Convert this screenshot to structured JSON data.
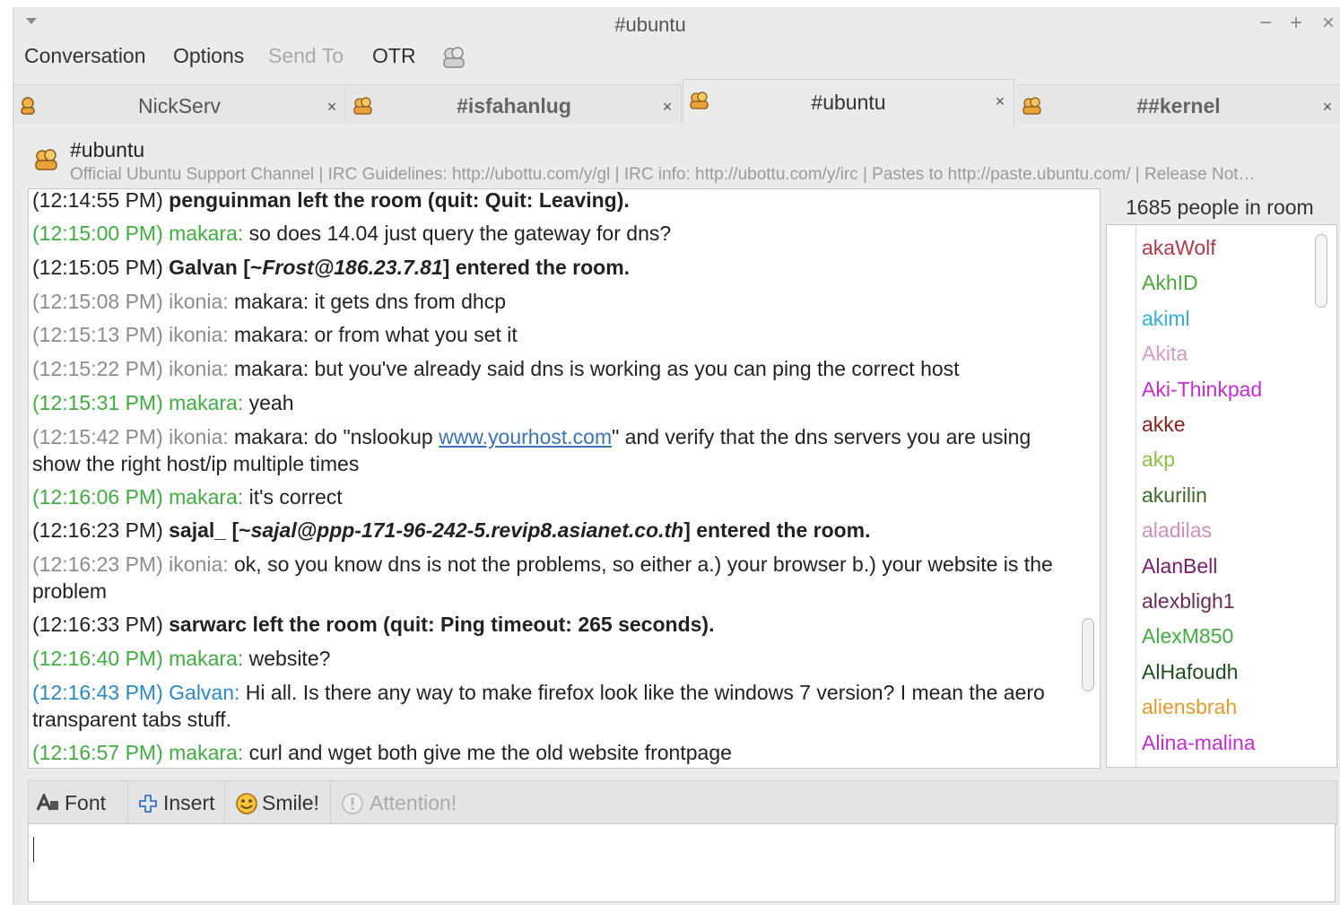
{
  "window": {
    "title": "#ubuntu",
    "minimize": "−",
    "maximize": "+",
    "close": "×"
  },
  "menubar": [
    "Conversation",
    "Options",
    "Send To",
    "OTR"
  ],
  "tabs": [
    {
      "label": "NickServ",
      "close": "×"
    },
    {
      "label": "#isfahanlug",
      "close": "×"
    },
    {
      "label": "#ubuntu",
      "close": "×"
    },
    {
      "label": "##kernel",
      "close": "×"
    }
  ],
  "topic": {
    "channel": "#ubuntu",
    "text": "Official Ubuntu Support Channel | IRC Guidelines: http://ubottu.com/y/gl | IRC info: http://ubottu.com/y/irc | Pastes to http://paste.ubuntu.com/ | Release Not…"
  },
  "messages": [
    {
      "time": "(12:14:55 PM)",
      "sys": "penguinman left the room (quit: Quit: Leaving)."
    },
    {
      "time": "(12:15:00 PM)",
      "nick": "makara:",
      "text": "so does 14.04 just query the gateway for dns?"
    },
    {
      "time": "(12:15:05 PM)",
      "sys_a": "Galvan [~",
      "sys_i": "Frost@186.23.7.81",
      "sys_b": "] entered the room."
    },
    {
      "time": "(12:15:08 PM)",
      "nick": "ikonia:",
      "text": "makara: it gets dns from dhcp"
    },
    {
      "time": "(12:15:13 PM)",
      "nick": "ikonia:",
      "text": "makara: or from what you set it"
    },
    {
      "time": "(12:15:22 PM)",
      "nick": "ikonia:",
      "text": "makara: but you've already said dns is working as you can ping the correct host"
    },
    {
      "time": "(12:15:31 PM)",
      "nick": "makara:",
      "text": "yeah"
    },
    {
      "time": "(12:15:42 PM)",
      "nick": "ikonia:",
      "text_a": "makara: do \"nslookup ",
      "link": "www.yourhost.com",
      "text_b": "\" and verify that the dns servers you are using show the right host/ip multiple times"
    },
    {
      "time": "(12:16:06 PM)",
      "nick": "makara:",
      "text": "it's correct"
    },
    {
      "time": "(12:16:23 PM)",
      "sys_a": "sajal_ [~",
      "sys_i": "sajal@ppp-171-96-242-5.revip8.asianet.co.th",
      "sys_b": "] entered the room."
    },
    {
      "time": "(12:16:23 PM)",
      "nick": "ikonia:",
      "text": "ok, so you know dns is not the problems, so either a.) your browser b.) your website is the problem"
    },
    {
      "time": "(12:16:33 PM)",
      "sys": "sarwarc left the room (quit: Ping timeout: 265 seconds)."
    },
    {
      "time": "(12:16:40 PM)",
      "nick": "makara:",
      "text": "website?"
    },
    {
      "time": "(12:16:43 PM)",
      "nick": "Galvan:",
      "text": "Hi all. Is there any way to make firefox look like the windows 7 version? I mean the aero transparent tabs stuff."
    },
    {
      "time": "(12:16:57 PM)",
      "nick": "makara:",
      "text": "curl and wget both give me the old website frontpage"
    }
  ],
  "people_count": "1685 people in room",
  "users": [
    {
      "name": "akaWolf",
      "color": "#b03a4a"
    },
    {
      "name": "AkhID",
      "color": "#4aa83a"
    },
    {
      "name": "akiml",
      "color": "#2cb5d6"
    },
    {
      "name": "Akita",
      "color": "#d79ac4"
    },
    {
      "name": "Aki-Thinkpad",
      "color": "#c62bd6"
    },
    {
      "name": "akke",
      "color": "#8a1c1c"
    },
    {
      "name": "akp",
      "color": "#8bc34a"
    },
    {
      "name": "akurilin",
      "color": "#3e6b2a"
    },
    {
      "name": "aladilas",
      "color": "#cf8fc0"
    },
    {
      "name": "AlanBell",
      "color": "#7a1d6b"
    },
    {
      "name": "alexbligh1",
      "color": "#6a2a5a"
    },
    {
      "name": "AlexM850",
      "color": "#3fae3f"
    },
    {
      "name": "AlHafoudh",
      "color": "#1f4d1f"
    },
    {
      "name": "aliensbrah",
      "color": "#e69a2e"
    },
    {
      "name": "Alina-malina",
      "color": "#c62bd6"
    }
  ],
  "toolbar": {
    "font": "Font",
    "insert": "Insert",
    "smile": "Smile!",
    "attention": "Attention!"
  },
  "input": {
    "value": ""
  }
}
